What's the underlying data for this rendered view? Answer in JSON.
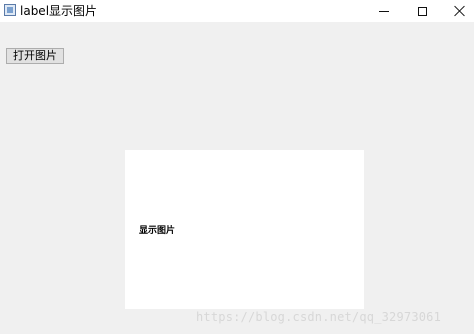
{
  "window": {
    "title": "label显示图片",
    "icon": "app-window-icon",
    "controls": {
      "minimize": "minimize-icon",
      "maximize": "maximize-icon",
      "close": "close-icon"
    }
  },
  "toolbar": {
    "open_image_label": "打开图片"
  },
  "image_label": {
    "text": "显示图片"
  },
  "watermark": {
    "text": "https://blog.csdn.net/qq_32973061"
  },
  "colors": {
    "window_bg": "#f0f0f0",
    "label_bg": "#ffffff",
    "button_bg": "#e1e1e1"
  }
}
